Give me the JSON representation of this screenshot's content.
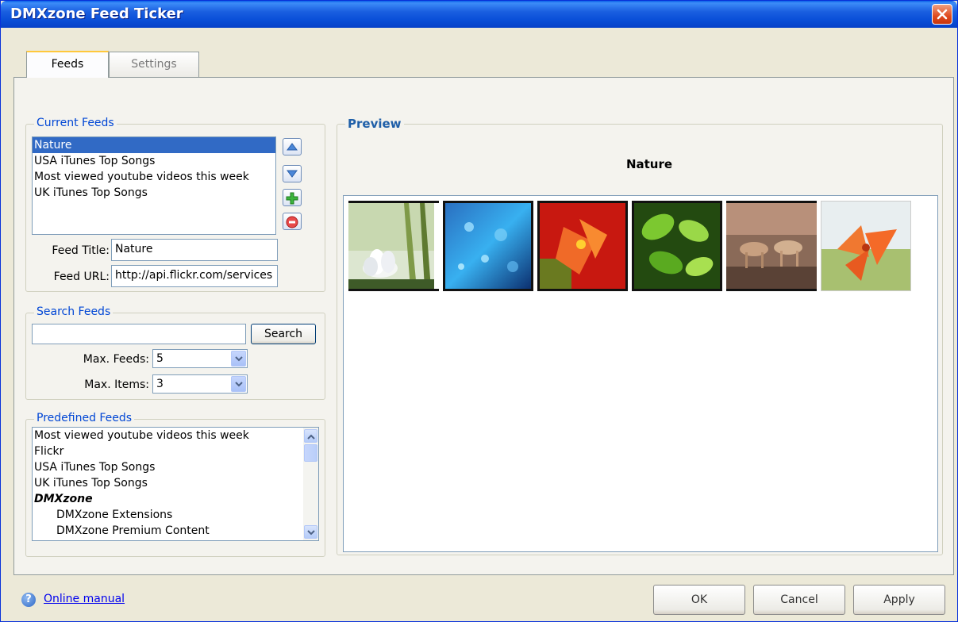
{
  "window": {
    "title": "DMXzone Feed Ticker"
  },
  "tabs": [
    {
      "label": "Feeds",
      "active": true
    },
    {
      "label": "Settings",
      "active": false
    }
  ],
  "current_feeds": {
    "legend": "Current Feeds",
    "items": [
      "Nature",
      "USA iTunes Top Songs",
      "Most viewed youtube videos this week",
      "UK iTunes Top Songs"
    ],
    "selected_index": 0,
    "feed_title_label": "Feed Title:",
    "feed_title_value": "Nature",
    "feed_url_label": "Feed URL:",
    "feed_url_value": "http://api.flickr.com/services"
  },
  "search_feeds": {
    "legend": "Search Feeds",
    "search_value": "",
    "search_button": "Search",
    "max_feeds_label": "Max. Feeds:",
    "max_feeds_value": "5",
    "max_items_label": "Max. Items:",
    "max_items_value": "3"
  },
  "predefined_feeds": {
    "legend": "Predefined Feeds",
    "items": [
      {
        "label": "Most viewed youtube videos this week",
        "indent": false,
        "header": false
      },
      {
        "label": "Flickr",
        "indent": false,
        "header": false
      },
      {
        "label": "USA iTunes Top Songs",
        "indent": false,
        "header": false
      },
      {
        "label": "UK iTunes Top Songs",
        "indent": false,
        "header": false
      },
      {
        "label": "DMXzone",
        "indent": false,
        "header": true
      },
      {
        "label": "DMXzone Extensions",
        "indent": true,
        "header": false
      },
      {
        "label": "DMXzone Premium Content",
        "indent": true,
        "header": false
      }
    ]
  },
  "preview": {
    "legend": "Preview",
    "feed_name": "Nature",
    "thumbnails": [
      {
        "name": "white-flower-photo",
        "colors": [
          "#E8EEE0",
          "#9FB880",
          "#3E5A28"
        ]
      },
      {
        "name": "blue-water-drops-photo",
        "colors": [
          "#7FD0F0",
          "#1E7FC8",
          "#0A2A60"
        ]
      },
      {
        "name": "red-orange-flower-photo",
        "colors": [
          "#F06030",
          "#C81810",
          "#3A1008"
        ]
      },
      {
        "name": "green-leaves-photo",
        "colors": [
          "#A8D850",
          "#4A9A20",
          "#142E08"
        ]
      },
      {
        "name": "dogs-running-photo",
        "colors": [
          "#C8A890",
          "#8A6450",
          "#4A3024"
        ]
      },
      {
        "name": "orange-blossom-photo",
        "colors": [
          "#F8E8D8",
          "#F07830",
          "#B83410"
        ]
      }
    ]
  },
  "footer": {
    "manual_link": "Online manual",
    "ok": "OK",
    "cancel": "Cancel",
    "apply": "Apply"
  }
}
